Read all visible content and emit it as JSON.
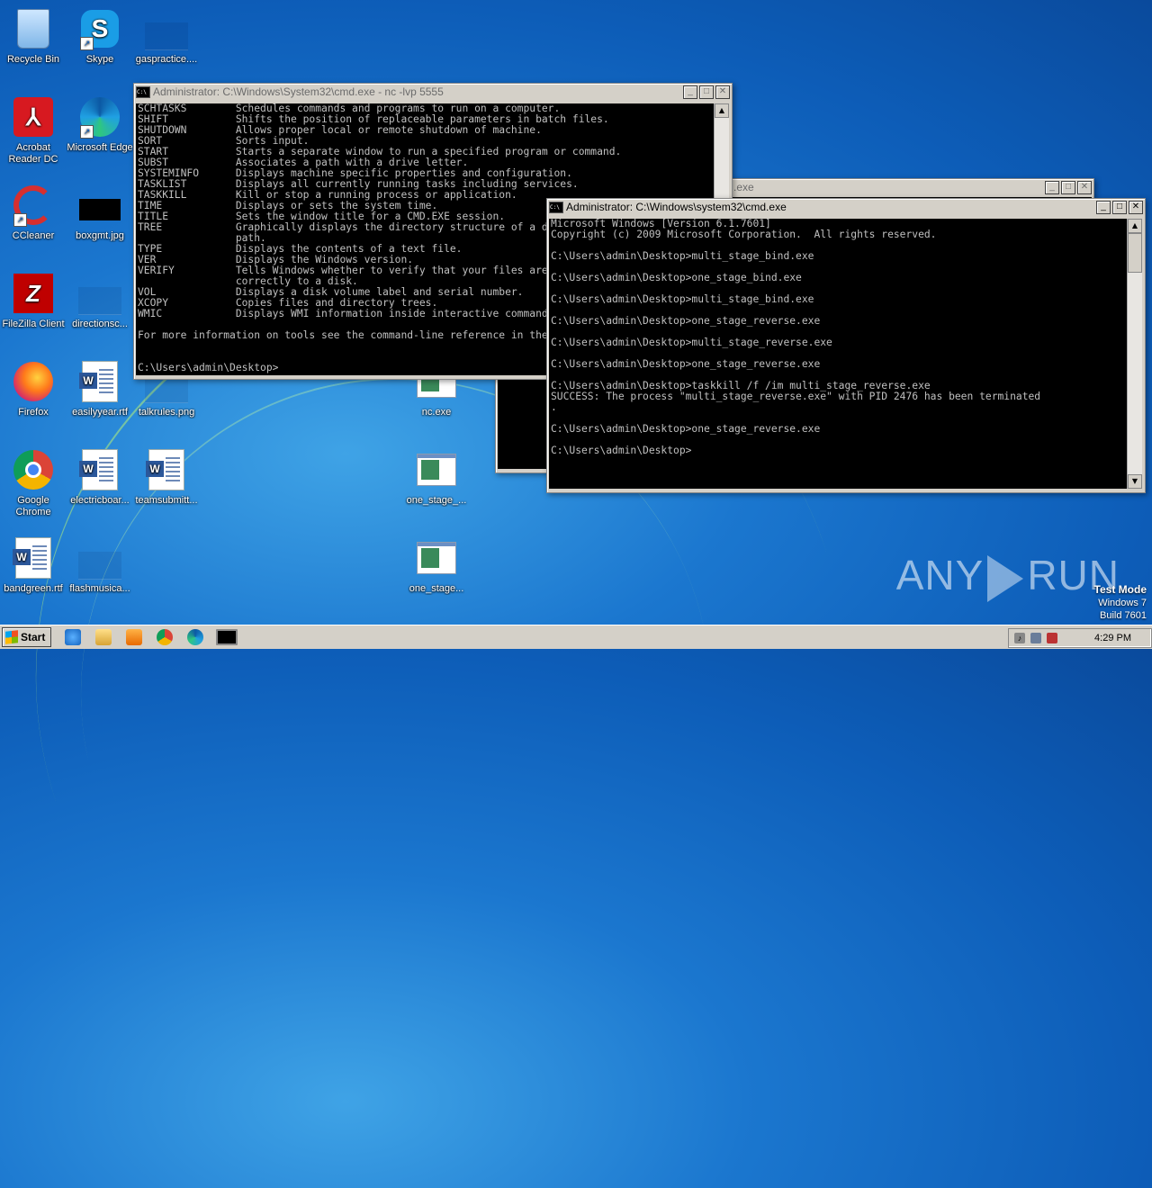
{
  "desktop": {
    "icons": [
      {
        "label": "Recycle Bin"
      },
      {
        "label": "Skype"
      },
      {
        "label": "gaspractice...."
      },
      {
        "label": "Acrobat Reader DC"
      },
      {
        "label": "Microsoft Edge"
      },
      {
        "label": "CCleaner"
      },
      {
        "label": "boxgmt.jpg"
      },
      {
        "label": "FileZilla Client"
      },
      {
        "label": "directionsc..."
      },
      {
        "label": "Firefox"
      },
      {
        "label": "easilyyear.rtf"
      },
      {
        "label": "talkrules.png"
      },
      {
        "label": "nc.exe"
      },
      {
        "label": "Google Chrome"
      },
      {
        "label": "electricboar..."
      },
      {
        "label": "teamsubmitt..."
      },
      {
        "label": "one_stage_..."
      },
      {
        "label": "bandgreen.rtf"
      },
      {
        "label": "flashmusica..."
      },
      {
        "label": "one_stage..."
      }
    ]
  },
  "window_nc": {
    "title": "Administrator: C:\\Windows\\System32\\cmd.exe - nc  -lvp 5555",
    "icon": "cmd-icon",
    "console_text": "SCHTASKS        Schedules commands and programs to run on a computer.\nSHIFT           Shifts the position of replaceable parameters in batch files.\nSHUTDOWN        Allows proper local or remote shutdown of machine.\nSORT            Sorts input.\nSTART           Starts a separate window to run a specified program or command.\nSUBST           Associates a path with a drive letter.\nSYSTEMINFO      Displays machine specific properties and configuration.\nTASKLIST        Displays all currently running tasks including services.\nTASKKILL        Kill or stop a running process or application.\nTIME            Displays or sets the system time.\nTITLE           Sets the window title for a CMD.EXE session.\nTREE            Graphically displays the directory structure of a drive or\n                path.\nTYPE            Displays the contents of a text file.\nVER             Displays the Windows version.\nVERIFY          Tells Windows whether to verify that your files are written\n                correctly to a disk.\nVOL             Displays a disk volume label and serial number.\nXCOPY           Copies files and directory trees.\nWMIC            Displays WMI information inside interactive command shell.\n\nFor more information on tools see the command-line reference in the online help.\n\n\nC:\\Users\\admin\\Desktop>"
  },
  "window_middle": {
    "title_fragment": ".exe"
  },
  "window_cmd": {
    "title": "Administrator: C:\\Windows\\system32\\cmd.exe",
    "icon": "cmd-icon",
    "console_text": "Microsoft Windows [Version 6.1.7601]\nCopyright (c) 2009 Microsoft Corporation.  All rights reserved.\n\nC:\\Users\\admin\\Desktop>multi_stage_bind.exe\n\nC:\\Users\\admin\\Desktop>one_stage_bind.exe\n\nC:\\Users\\admin\\Desktop>multi_stage_bind.exe\n\nC:\\Users\\admin\\Desktop>one_stage_reverse.exe\n\nC:\\Users\\admin\\Desktop>multi_stage_reverse.exe\n\nC:\\Users\\admin\\Desktop>one_stage_reverse.exe\n\nC:\\Users\\admin\\Desktop>taskkill /f /im multi_stage_reverse.exe\nSUCCESS: The process \"multi_stage_reverse.exe\" with PID 2476 has been terminated\n.\n\nC:\\Users\\admin\\Desktop>one_stage_reverse.exe\n\nC:\\Users\\admin\\Desktop>"
  },
  "taskbar": {
    "start_label": "Start",
    "quick_launch": [
      "ie-icon",
      "explorer-icon",
      "media-player-icon",
      "chrome-icon",
      "edge-icon",
      "cmd-icon"
    ],
    "clock": "4:29 PM"
  },
  "watermark": {
    "left": "ANY",
    "right": "RUN"
  },
  "test_mode": {
    "line1": "Test Mode",
    "line2": "Windows 7",
    "line3": "Build 7601"
  },
  "colors": {
    "console_bg": "#000000",
    "console_fg": "#c0c0c0",
    "desktop_blue": "#1b77cf"
  }
}
